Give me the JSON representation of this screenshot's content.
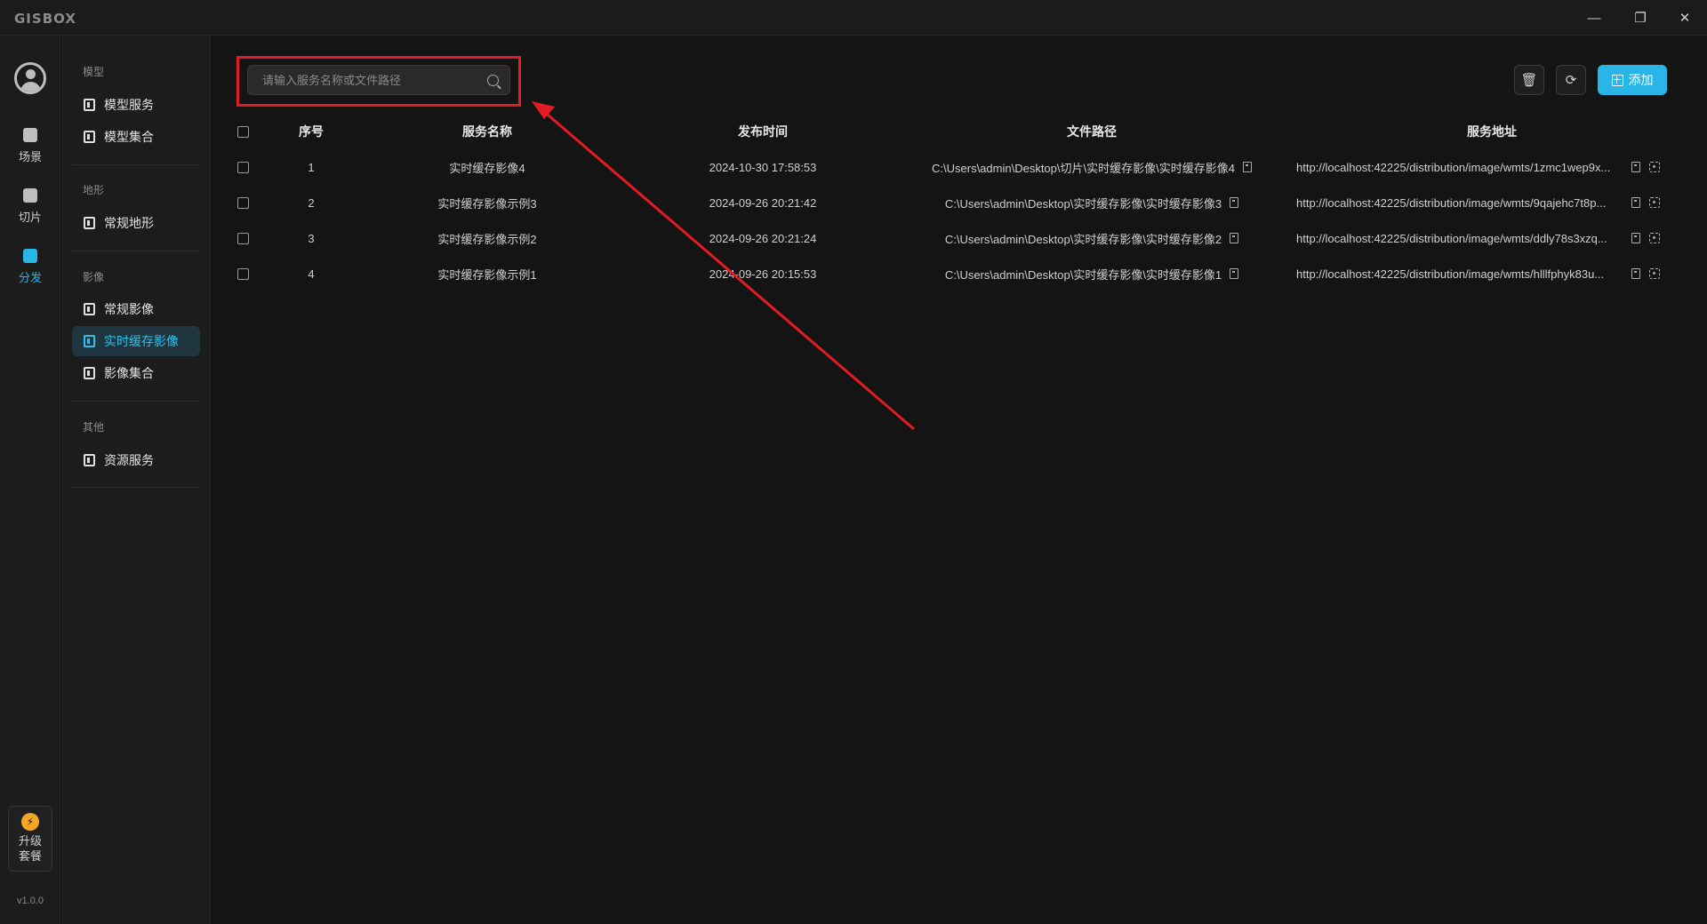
{
  "app": {
    "logo": "GISBOX"
  },
  "window_controls": {
    "minimize": "—",
    "maximize": "❐",
    "close": "✕"
  },
  "rail": {
    "items": [
      {
        "label": "场景",
        "icon": "home-icon"
      },
      {
        "label": "切片",
        "icon": "slice-icon"
      },
      {
        "label": "分发",
        "icon": "distribute-icon",
        "active": true
      }
    ],
    "upgrade_label": "升级套餐",
    "version": "v1.0.0"
  },
  "sidebar": {
    "sections": [
      {
        "title": "模型",
        "items": [
          "模型服务",
          "模型集合"
        ]
      },
      {
        "title": "地形",
        "items": [
          "常规地形"
        ]
      },
      {
        "title": "影像",
        "items": [
          "常规影像",
          "实时缓存影像",
          "影像集合"
        ]
      },
      {
        "title": "其他",
        "items": [
          "资源服务"
        ]
      }
    ],
    "active_item": "实时缓存影像"
  },
  "search": {
    "placeholder": "请输入服务名称或文件路径",
    "value": ""
  },
  "toolbar": {
    "add_label": "添加"
  },
  "table": {
    "headers": {
      "index": "序号",
      "name": "服务名称",
      "time": "发布时间",
      "path": "文件路径",
      "address": "服务地址"
    },
    "rows": [
      {
        "index": "1",
        "name": "实时缓存影像4",
        "time": "2024-10-30 17:58:53",
        "path": "C:\\Users\\admin\\Desktop\\切片\\实时缓存影像\\实时缓存影像4",
        "address": "http://localhost:42225/distribution/image/wmts/1zmc1wep9x..."
      },
      {
        "index": "2",
        "name": "实时缓存影像示例3",
        "time": "2024-09-26 20:21:42",
        "path": "C:\\Users\\admin\\Desktop\\实时缓存影像\\实时缓存影像3",
        "address": "http://localhost:42225/distribution/image/wmts/9qajehc7t8p..."
      },
      {
        "index": "3",
        "name": "实时缓存影像示例2",
        "time": "2024-09-26 20:21:24",
        "path": "C:\\Users\\admin\\Desktop\\实时缓存影像\\实时缓存影像2",
        "address": "http://localhost:42225/distribution/image/wmts/ddly78s3xzq..."
      },
      {
        "index": "4",
        "name": "实时缓存影像示例1",
        "time": "2024-09-26 20:15:53",
        "path": "C:\\Users\\admin\\Desktop\\实时缓存影像\\实时缓存影像1",
        "address": "http://localhost:42225/distribution/image/wmts/hlllfphyk83u..."
      }
    ]
  },
  "colors": {
    "accent": "#29b6e6",
    "highlight": "#e31b23",
    "background": "#141414"
  }
}
